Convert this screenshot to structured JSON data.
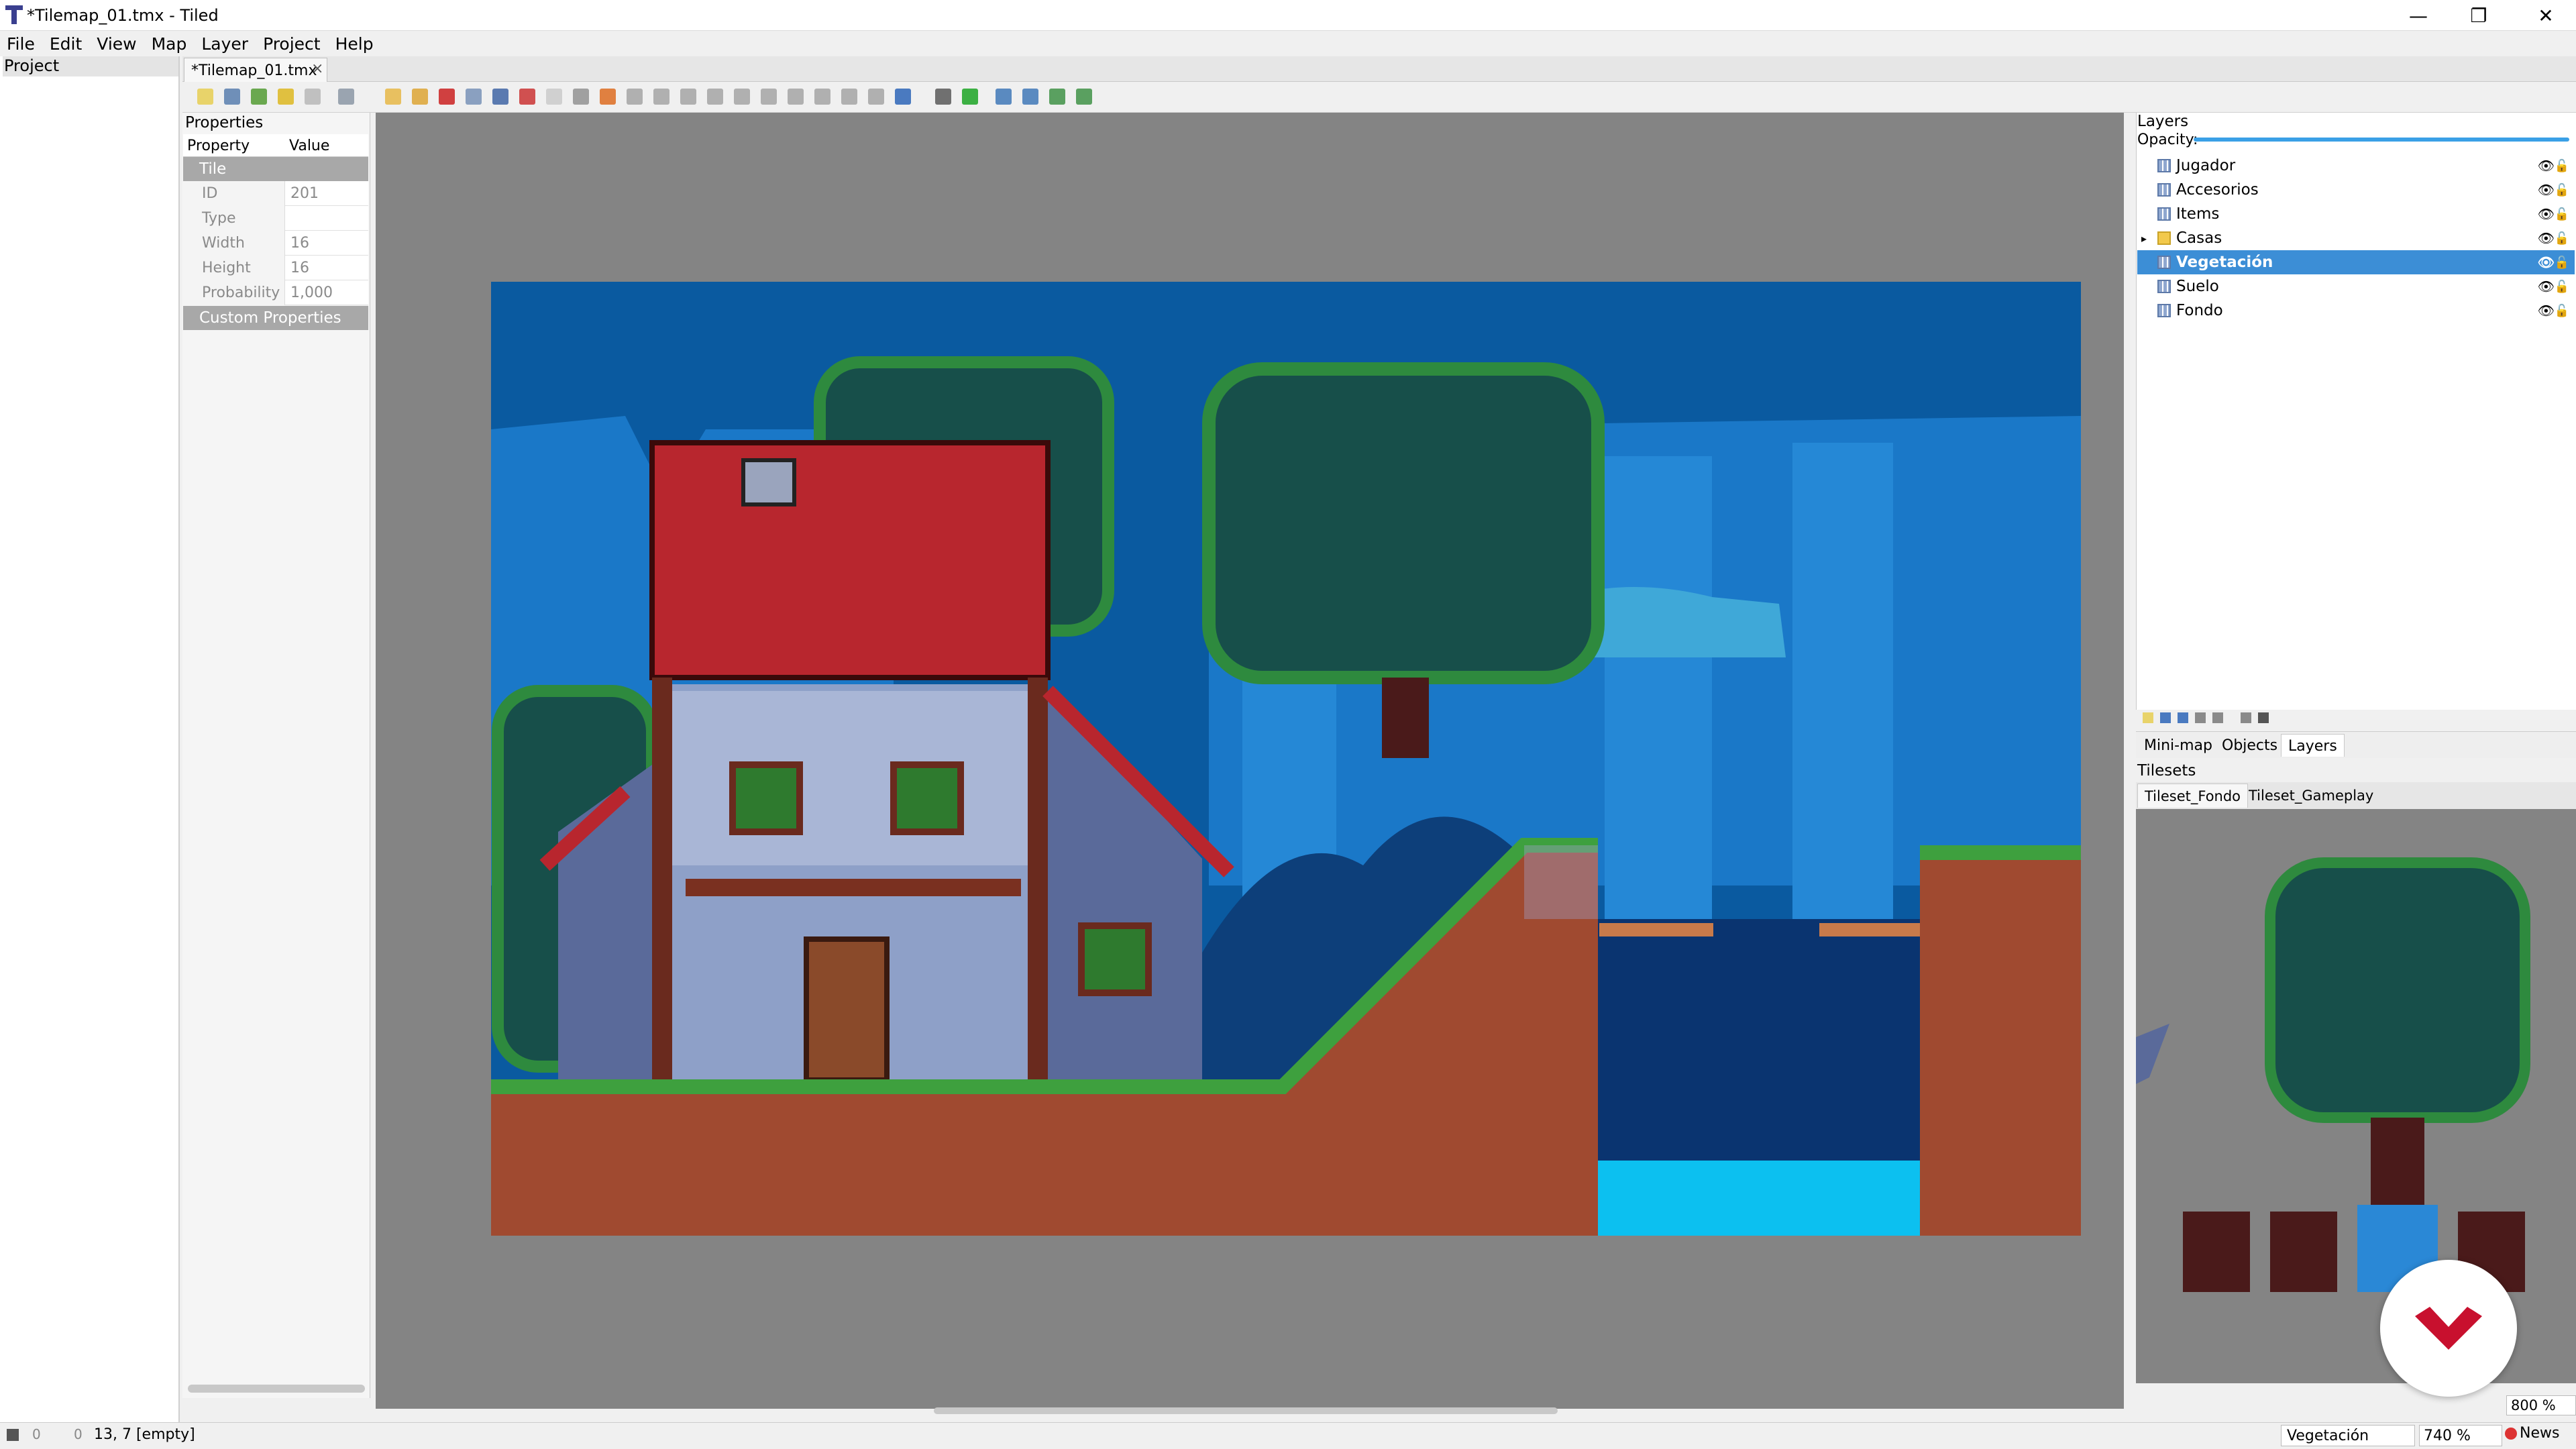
{
  "window": {
    "title": "*Tilemap_01.tmx - Tiled",
    "minimize": "—",
    "maximize": "❐",
    "close": "✕"
  },
  "menu": [
    "File",
    "Edit",
    "View",
    "Map",
    "Layer",
    "Project",
    "Help"
  ],
  "project_panel": {
    "title": "Project"
  },
  "document_tab": {
    "label": "*Tilemap_01.tmx",
    "close": "×"
  },
  "properties": {
    "title": "Properties",
    "col_property": "Property",
    "col_value": "Value",
    "group_tile": "Tile",
    "rows": [
      {
        "name": "ID",
        "value": "201"
      },
      {
        "name": "Type",
        "value": ""
      },
      {
        "name": "Width",
        "value": "16"
      },
      {
        "name": "Height",
        "value": "16"
      },
      {
        "name": "Probability",
        "value": "1,000"
      }
    ],
    "group_custom": "Custom Properties"
  },
  "layers": {
    "title": "Layers",
    "opacity_label": "Opacity:",
    "items": [
      {
        "name": "Jugador",
        "selected": false
      },
      {
        "name": "Accesorios",
        "selected": false
      },
      {
        "name": "Items",
        "selected": false
      },
      {
        "name": "Casas",
        "selected": false,
        "group": true
      },
      {
        "name": "Vegetación",
        "selected": true
      },
      {
        "name": "Suelo",
        "selected": false
      },
      {
        "name": "Fondo",
        "selected": false
      }
    ]
  },
  "dock_tabs": [
    "Mini-map",
    "Objects",
    "Layers"
  ],
  "tilesets": {
    "title": "Tilesets",
    "tabs": [
      "Tileset_Fondo",
      "Tileset_Gameplay"
    ],
    "zoom": "800 %"
  },
  "status": {
    "coords": "13, 7 [empty]",
    "current_layer": "Vegetación",
    "zoom": "740 %",
    "news": "News",
    "errors": "0",
    "warnings": "0"
  },
  "colors": {
    "selection": "#3c8ed6",
    "canvas_bg": "#848484",
    "sky": "#0a5aa0",
    "brand_red": "#c8102e"
  }
}
